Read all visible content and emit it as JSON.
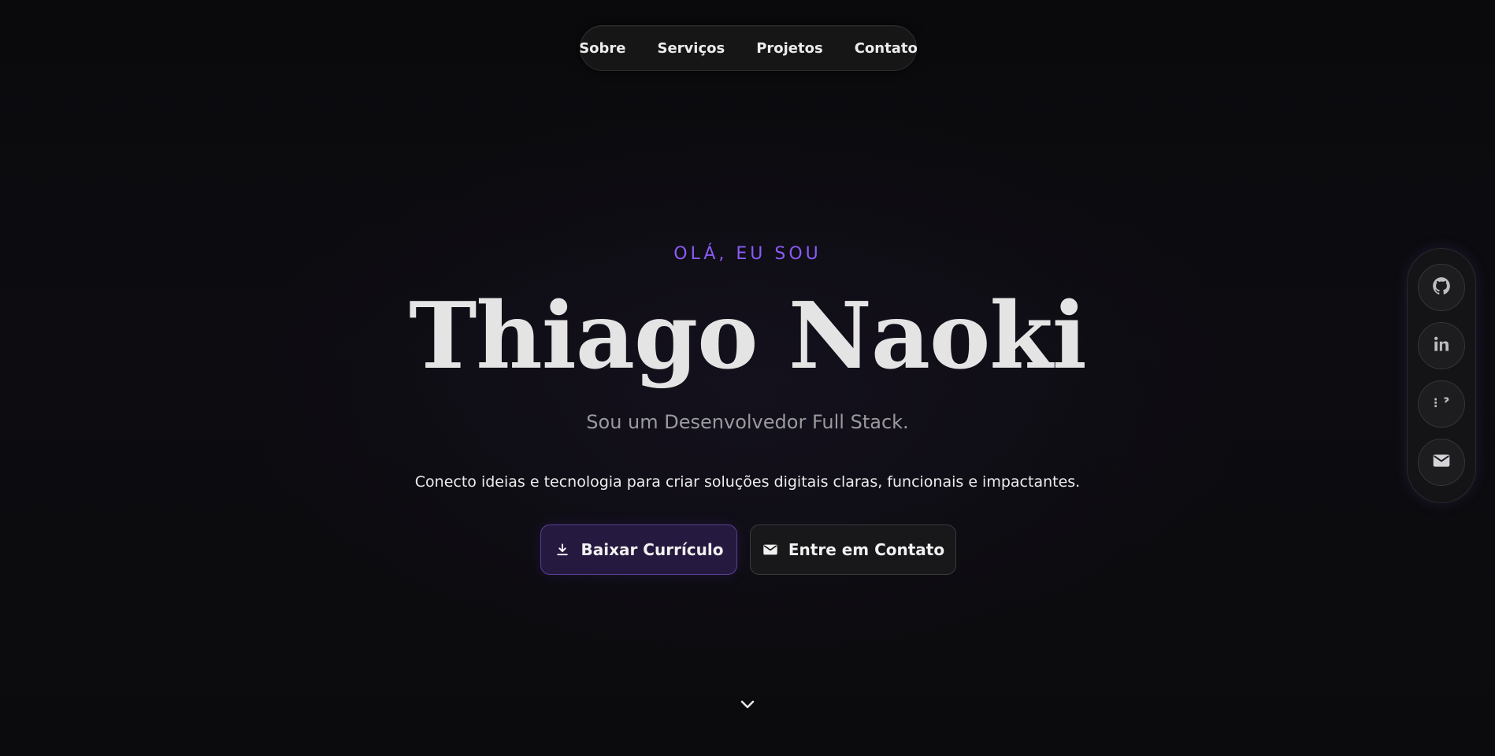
{
  "nav": {
    "items": [
      {
        "label": "Sobre"
      },
      {
        "label": "Serviços"
      },
      {
        "label": "Projetos"
      },
      {
        "label": "Contato"
      }
    ]
  },
  "hero": {
    "eyebrow": "OLÁ, EU SOU",
    "name": "Thiago Naoki",
    "subtitle": "Sou um Desenvolvedor Full Stack.",
    "description": "Conecto ideias e tecnologia para criar soluções digitais claras, funcionais e impactantes.",
    "buttons": {
      "download": {
        "label": "Baixar Currículo",
        "icon": "download-icon"
      },
      "contact": {
        "label": "Entre em Contato",
        "icon": "mail-icon"
      }
    },
    "scroll_icon": "chevron-down-icon"
  },
  "social": {
    "items": [
      {
        "icon": "github-icon"
      },
      {
        "icon": "linkedin-icon"
      },
      {
        "icon": "portfolio-icon"
      },
      {
        "icon": "email-icon"
      }
    ]
  },
  "colors": {
    "background": "#0b0b0d",
    "accent": "#8b5cf6",
    "primary_button_bg": "#26193f",
    "text": "#e4e4e4",
    "muted_text": "#9a9a9e"
  }
}
